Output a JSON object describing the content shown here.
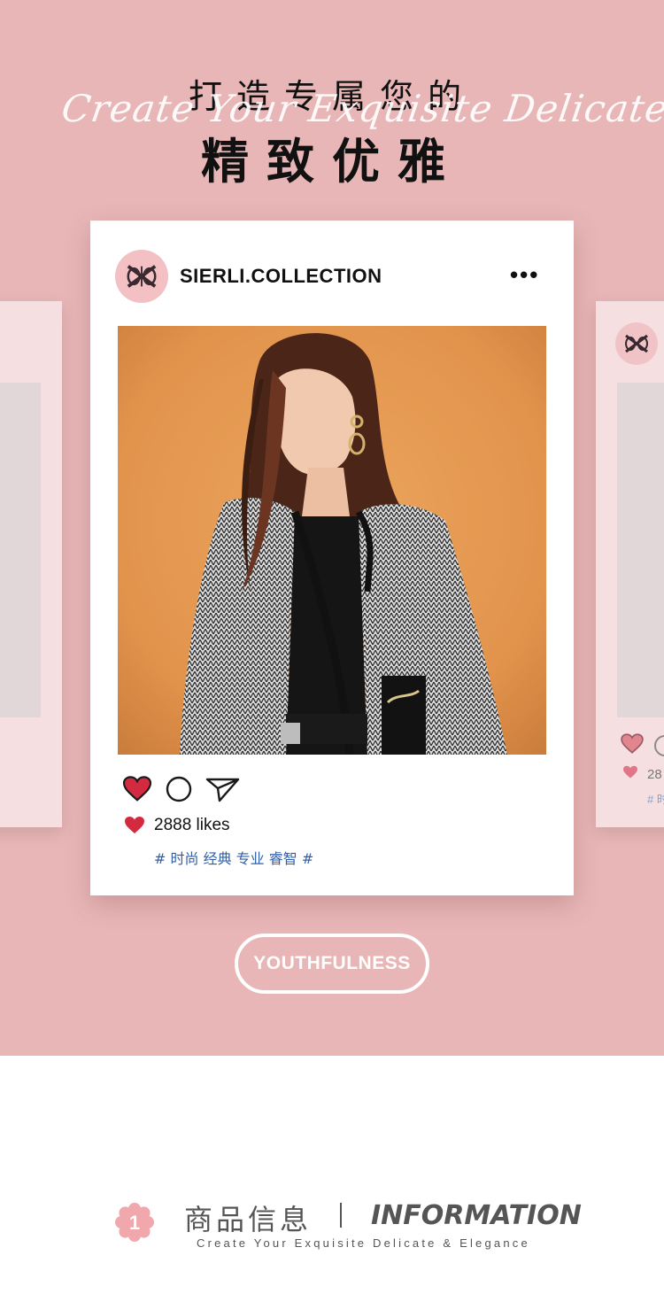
{
  "header": {
    "script_text": "Create Your Exquisite Delicate & Elegance",
    "title_line1": "打造专属您的",
    "title_line2": "精致优雅"
  },
  "post": {
    "brand": "SIERLI.COLLECTION",
    "more_menu": "•••",
    "likes": "2888 likes",
    "hashtags": "# 时尚 经典 专业 睿智 #",
    "liked": true
  },
  "side_card_right": {
    "likes_partial": "28",
    "hashtag_partial": "# 时"
  },
  "cta": {
    "label": "YOUTHFULNESS"
  },
  "info_section": {
    "number": "1",
    "title_cn": "商品信息",
    "title_en": "INFORMATION",
    "subtitle": "Create Your Exquisite Delicate & Elegance"
  },
  "colors": {
    "hero_background": "#e8b6b7",
    "heart_red": "#d42a40",
    "hashtag_blue": "#2f5fa8",
    "avatar_pink": "#f3c1c4",
    "photo_backdrop": "#e39a52"
  },
  "icons": [
    "brand-logo-icon",
    "more-icon",
    "heart-icon",
    "comment-icon",
    "share-icon",
    "flower-number-icon"
  ]
}
